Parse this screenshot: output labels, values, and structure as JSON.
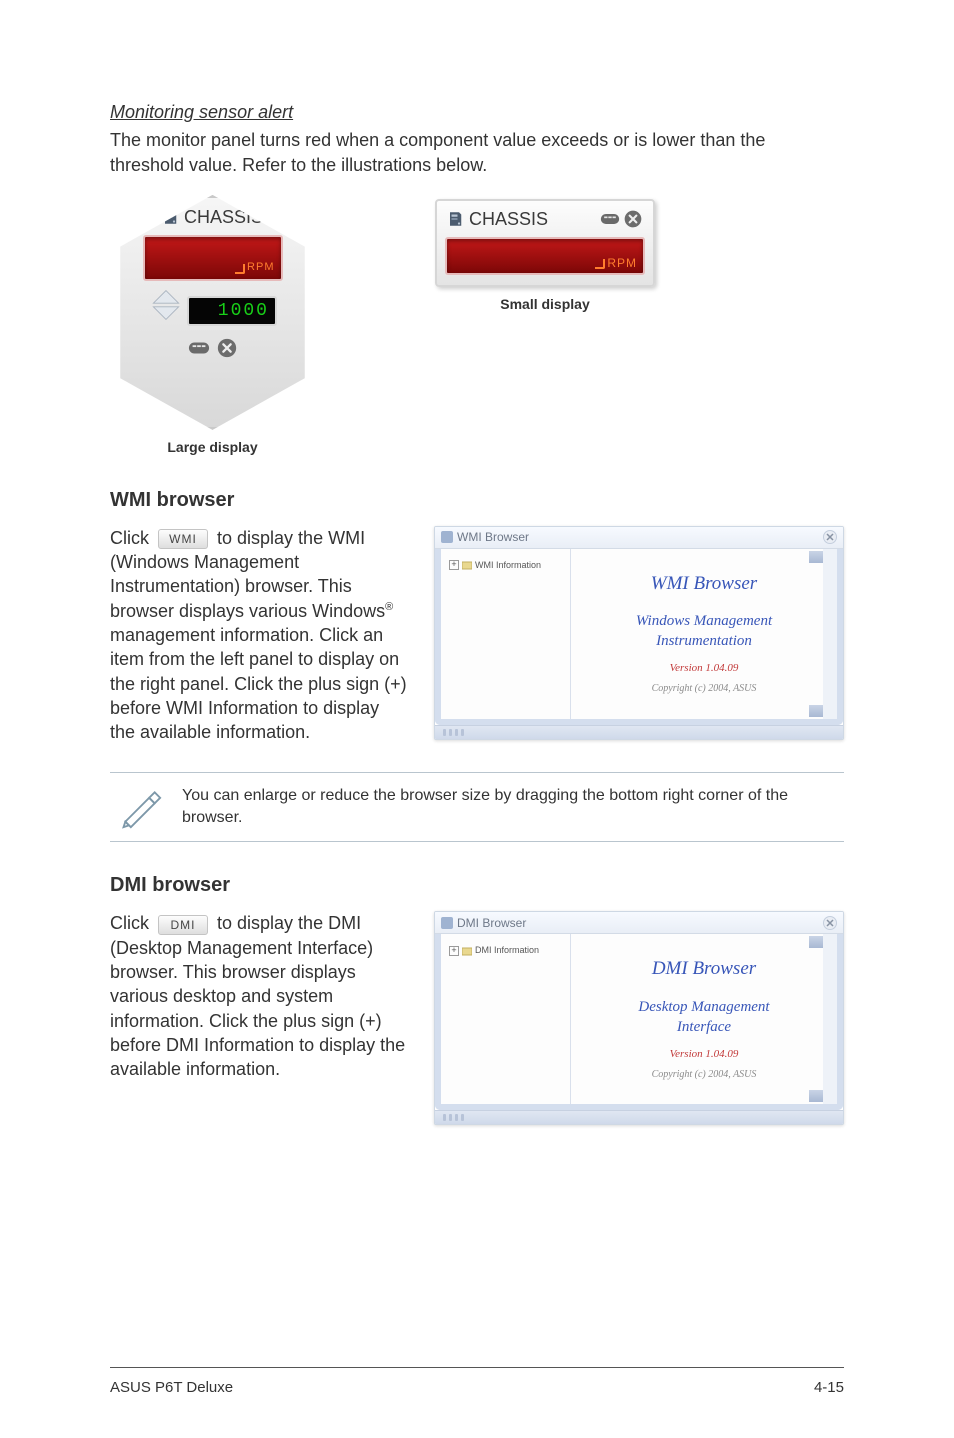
{
  "monitoring": {
    "subheading": "Monitoring sensor alert",
    "body": "The monitor panel turns red when a component value exceeds or is lower than the threshold value. Refer to the illustrations below.",
    "largePanel": {
      "title": "CHASSIS",
      "rpmLabel": "RPM",
      "thresholdDisplay": "1000",
      "caption": "Large display"
    },
    "smallPanel": {
      "title": "CHASSIS",
      "rpmLabel": "RPM",
      "caption": "Small display"
    }
  },
  "wmi": {
    "heading": "WMI browser",
    "bodyPrefix": "Click ",
    "chip": "WMI",
    "bodyRest": " to display the WMI (Windows Management Instrumentation) browser. This browser displays various Windows",
    "regMark": "®",
    "bodyAfterReg": " management information. Click an item from the left panel to display on the right panel. Click the plus sign (+) before WMI Information to display the available information.",
    "window": {
      "titlebar": "WMI Browser",
      "closeIcon": "close-icon",
      "treePlus": "+",
      "treeLabel": "WMI Information",
      "title": "WMI  Browser",
      "subtitle": "Windows Management\nInstrumentation",
      "version": "Version 1.04.09",
      "copyright": "Copyright (c) 2004,  ASUS"
    }
  },
  "note": {
    "text": "You can enlarge or reduce the browser size by dragging the bottom right corner of the browser."
  },
  "dmi": {
    "heading": "DMI browser",
    "bodyPrefix": "Click ",
    "chip": "DMI",
    "bodyRest": " to display the DMI (Desktop Management Interface) browser. This browser displays various desktop and system information. Click the plus sign (+) before DMI Information to display the available information.",
    "window": {
      "titlebar": "DMI Browser",
      "closeIcon": "close-icon",
      "treePlus": "+",
      "treeLabel": "DMI Information",
      "title": "DMI  Browser",
      "subtitle": "Desktop Management\nInterface",
      "version": "Version 1.04.09",
      "copyright": "Copyright (c) 2004,  ASUS"
    }
  },
  "footer": {
    "left": "ASUS P6T Deluxe",
    "right": "4-15"
  }
}
